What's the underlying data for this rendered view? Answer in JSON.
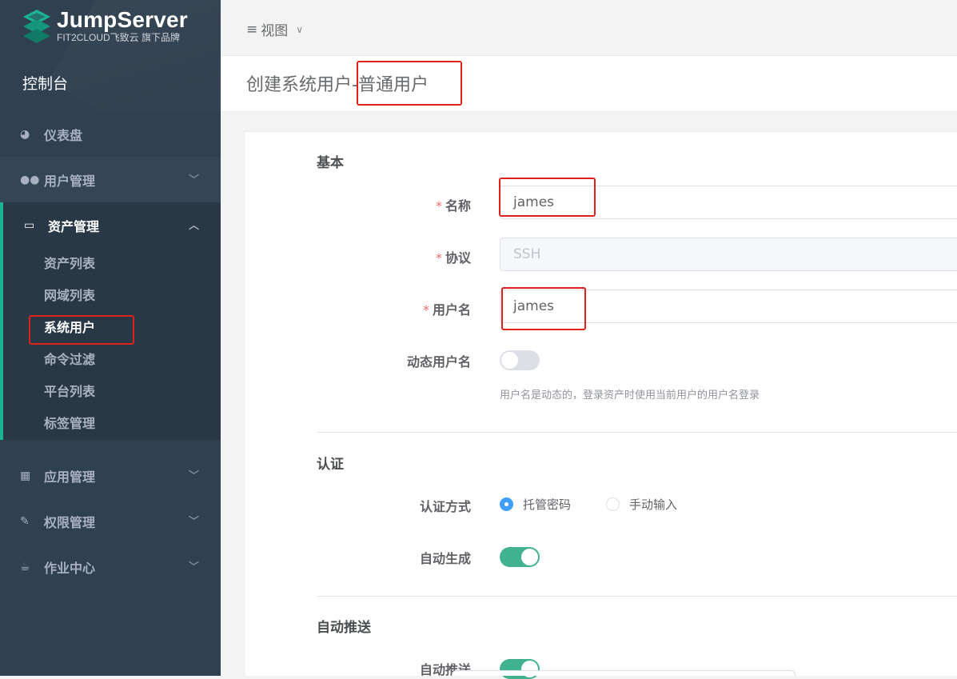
{
  "app": {
    "brand": "JumpServer",
    "brand_sub": "FIT2CLOUD飞致云 旗下品牌",
    "console": "控制台",
    "accent": "#1ab394"
  },
  "sidebar": {
    "items": [
      {
        "label": "仪表盘",
        "icon": "dashboard-icon"
      },
      {
        "label": "用户管理",
        "icon": "users-icon"
      },
      {
        "label": "资产管理",
        "icon": "inbox-icon"
      },
      {
        "label": "应用管理",
        "icon": "grid-icon"
      },
      {
        "label": "权限管理",
        "icon": "edit-icon"
      },
      {
        "label": "作业中心",
        "icon": "coffee-icon"
      }
    ],
    "asset_sub": [
      "资产列表",
      "网域列表",
      "系统用户",
      "命令过滤",
      "平台列表",
      "标签管理"
    ],
    "chevron_down": "﹀",
    "chevron_up": "︿"
  },
  "topbar": {
    "view_label": "视图",
    "bars": "≡",
    "caret": "∨"
  },
  "page": {
    "title": "创建系统用户-普通用户"
  },
  "form": {
    "section_basic": "基本",
    "name_label": "名称",
    "name_value": "james",
    "protocol_label": "协议",
    "protocol_value": "SSH",
    "username_label": "用户名",
    "username_value": "james",
    "dynamic_label": "动态用户名",
    "dynamic_hint": "用户名是动态的，登录资产时使用当前用户的用户名登录",
    "dynamic_on": false,
    "section_auth": "认证",
    "auth_method_label": "认证方式",
    "auth_options": [
      "托管密码",
      "手动输入"
    ],
    "auth_selected": "托管密码",
    "auto_generate_label": "自动生成",
    "auto_generate_on": true,
    "section_push": "自动推送",
    "auto_push_label": "自动推送",
    "auto_push_on": true,
    "required_mark": "*"
  }
}
